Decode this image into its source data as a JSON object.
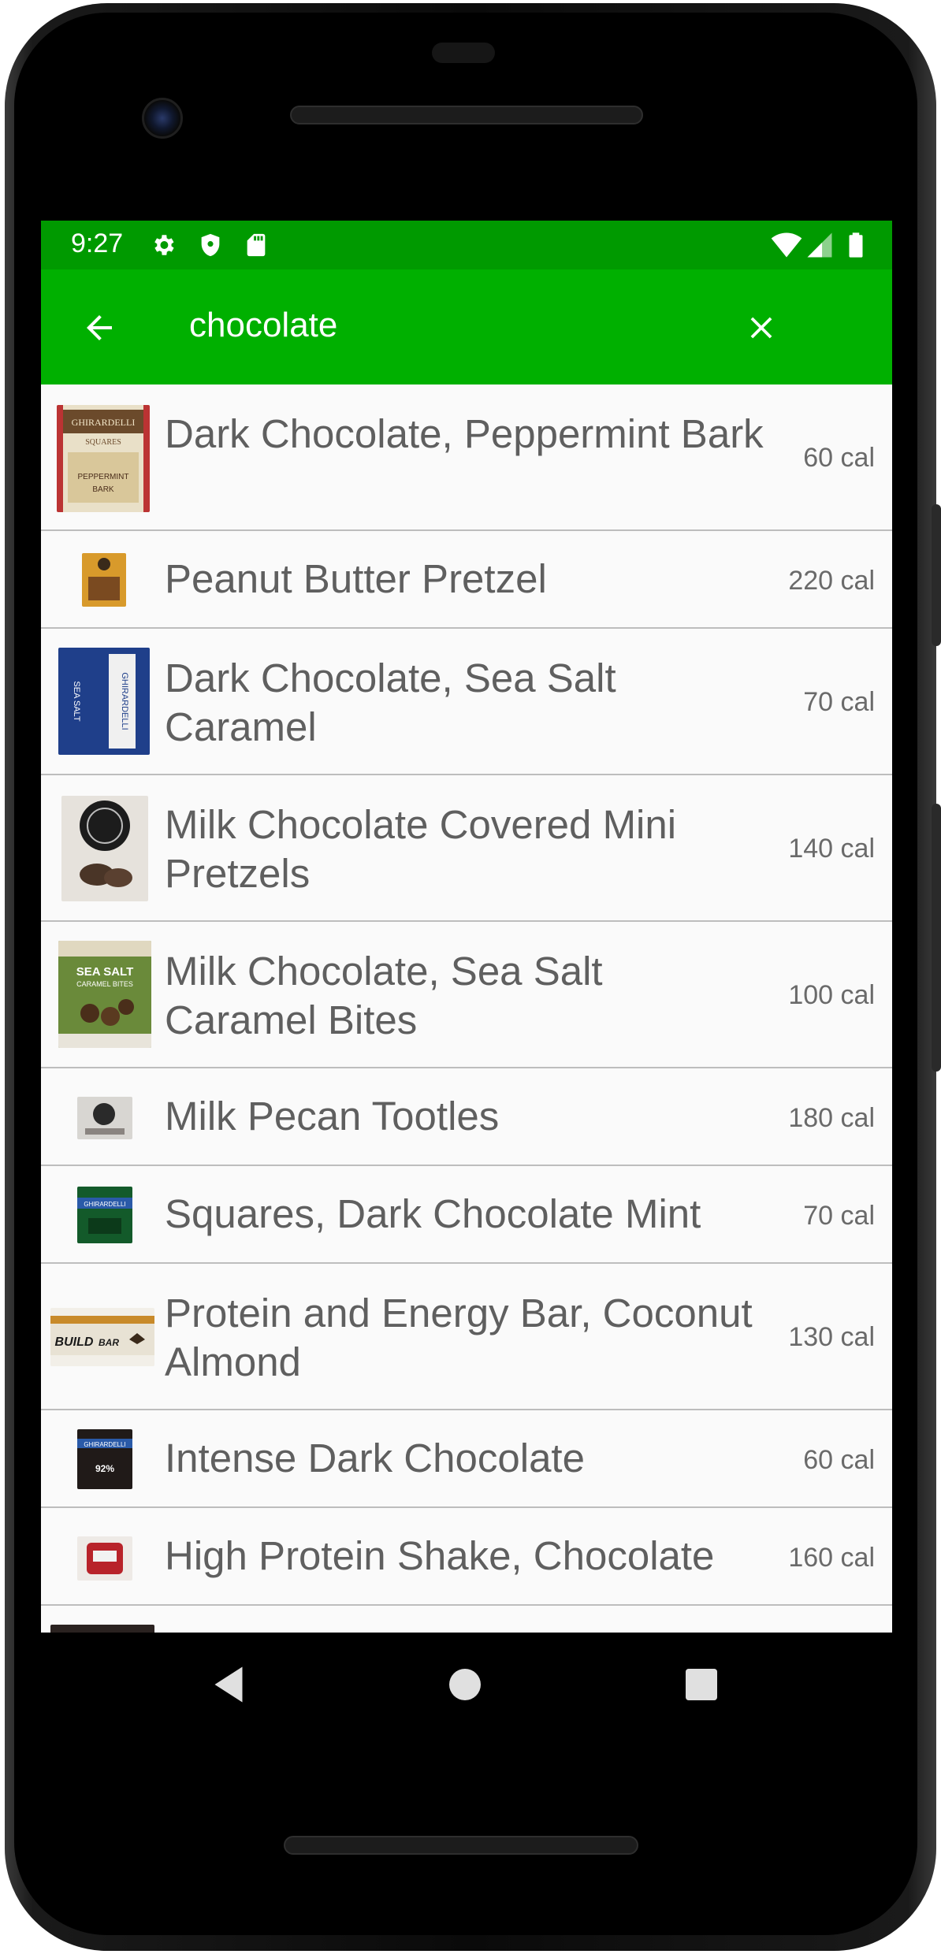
{
  "status_bar": {
    "time": "9:27",
    "icons_left": [
      "settings-icon",
      "shield-icon",
      "sd-card-icon"
    ],
    "icons_right": [
      "wifi-icon",
      "signal-icon",
      "battery-icon"
    ]
  },
  "app_bar": {
    "back_icon": "arrow-left-icon",
    "search_value": "chocolate",
    "clear_icon": "close-icon",
    "background": "#00b000",
    "status_background": "#009a00"
  },
  "results": [
    {
      "name": "Dark Chocolate, Peppermint Bark",
      "calories": "60 cal"
    },
    {
      "name": "Peanut Butter Pretzel",
      "calories": "220 cal"
    },
    {
      "name": "Dark Chocolate, Sea Salt Caramel",
      "calories": "70 cal"
    },
    {
      "name": "Milk Chocolate Covered Mini Pretzels",
      "calories": "140 cal"
    },
    {
      "name": "Milk Chocolate, Sea Salt Caramel Bites",
      "calories": "100 cal"
    },
    {
      "name": "Milk Pecan Tootles",
      "calories": "180 cal"
    },
    {
      "name": "Squares, Dark Chocolate Mint",
      "calories": "70 cal"
    },
    {
      "name": "Protein and Energy Bar, Coconut Almond",
      "calories": "130 cal"
    },
    {
      "name": "Intense Dark Chocolate",
      "calories": "60 cal"
    },
    {
      "name": "High Protein Shake, Chocolate",
      "calories": "160 cal"
    }
  ],
  "thumb_labels": {
    "ghirardelli": "GHIRARDELLI",
    "squares": "SQUARES",
    "peppermint": "PEPPERMINT",
    "bark": "BARK",
    "sea_salt": "SEA SALT",
    "caramel_bites": "CARAMEL BITES",
    "build": "BUILD",
    "bar": "BAR",
    "cacao": "92%"
  },
  "nav_bar": {
    "back": "triangle-back-icon",
    "home": "circle-home-icon",
    "recents": "square-recents-icon"
  }
}
